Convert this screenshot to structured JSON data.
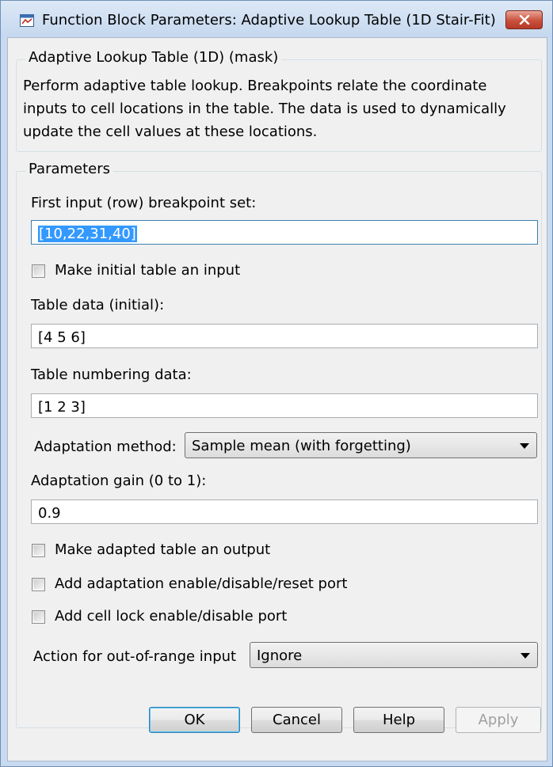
{
  "window": {
    "title": "Function Block Parameters: Adaptive Lookup Table (1D Stair-Fit)"
  },
  "header": {
    "legend": "Adaptive Lookup Table (1D) (mask)",
    "description": "Perform adaptive table lookup.  Breakpoints relate the coordinate inputs to cell locations in the table.  The data is used to dynamically update the cell values at these locations."
  },
  "parameters": {
    "legend": "Parameters",
    "first_input_label": "First input (row) breakpoint set:",
    "first_input_value": "[10,22,31,40]",
    "initial_table_input_label": "Make initial table an input",
    "table_data_label": "Table data (initial):",
    "table_data_value": "[4 5 6]",
    "table_numbering_label": "Table numbering data:",
    "table_numbering_value": "[1 2 3]",
    "adaptation_method_label": "Adaptation method:",
    "adaptation_method_value": "Sample mean (with forgetting)",
    "adaptation_gain_label": "Adaptation gain (0 to 1):",
    "adaptation_gain_value": "0.9",
    "adapted_output_label": "Make adapted table an output",
    "adaptation_port_label": "Add adaptation enable/disable/reset port",
    "cell_lock_label": "Add cell lock enable/disable port",
    "out_of_range_label": "Action for out-of-range input",
    "out_of_range_value": "Ignore"
  },
  "buttons": {
    "ok": "OK",
    "cancel": "Cancel",
    "help": "Help",
    "apply": "Apply"
  }
}
